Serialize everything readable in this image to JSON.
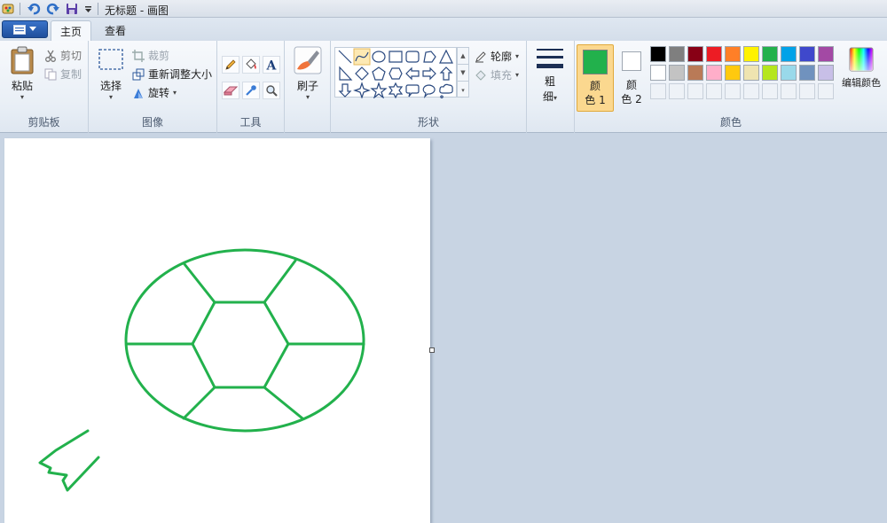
{
  "window": {
    "title": "无标题 - 画图"
  },
  "tabs": [
    {
      "label": "主页",
      "active": true
    },
    {
      "label": "查看",
      "active": false
    }
  ],
  "clipboard": {
    "paste": "粘贴",
    "cut": "剪切",
    "copy": "复制",
    "label": "剪贴板"
  },
  "image": {
    "select": "选择",
    "crop": "裁剪",
    "resize": "重新调整大小",
    "rotate": "旋转",
    "label": "图像"
  },
  "tools": {
    "label": "工具",
    "icons": [
      "pencil-icon",
      "fill-bucket-icon",
      "text-icon",
      "eraser-icon",
      "color-picker-icon",
      "magnifier-icon"
    ]
  },
  "brushes": {
    "label": "刷子"
  },
  "shapes": {
    "label": "形状",
    "outline": "轮廓",
    "fill": "填充",
    "items": [
      "line",
      "curve",
      "oval",
      "rectangle",
      "rounded-rectangle",
      "polygon",
      "triangle",
      "right-triangle",
      "diamond",
      "pentagon",
      "hexagon",
      "left-arrow",
      "right-arrow",
      "up-arrow",
      "down-arrow",
      "four-point-star",
      "five-point-star",
      "six-point-star",
      "rounded-callout",
      "oval-callout",
      "cloud-callout"
    ]
  },
  "size": {
    "label_line1": "粗",
    "label_line2": "细"
  },
  "colors": {
    "label": "颜色",
    "color1_line1": "颜",
    "color1_line2": "色 1",
    "color2_line1": "颜",
    "color2_line2": "色 2",
    "color1_value": "#22b14c",
    "color2_value": "#ffffff",
    "edit": "编辑颜色",
    "palette_row1": [
      "#000000",
      "#7f7f7f",
      "#880015",
      "#ed1c24",
      "#ff7f27",
      "#fff200",
      "#22b14c",
      "#00a2e8",
      "#3f48cc",
      "#a349a4"
    ],
    "palette_row2": [
      "#ffffff",
      "#c3c3c3",
      "#b97a57",
      "#ffaec9",
      "#ffc90e",
      "#efe4b0",
      "#b5e61d",
      "#99d9ea",
      "#7092be",
      "#c8bfe7"
    ]
  },
  "drawing": {
    "stroke_color": "#22b14c"
  }
}
